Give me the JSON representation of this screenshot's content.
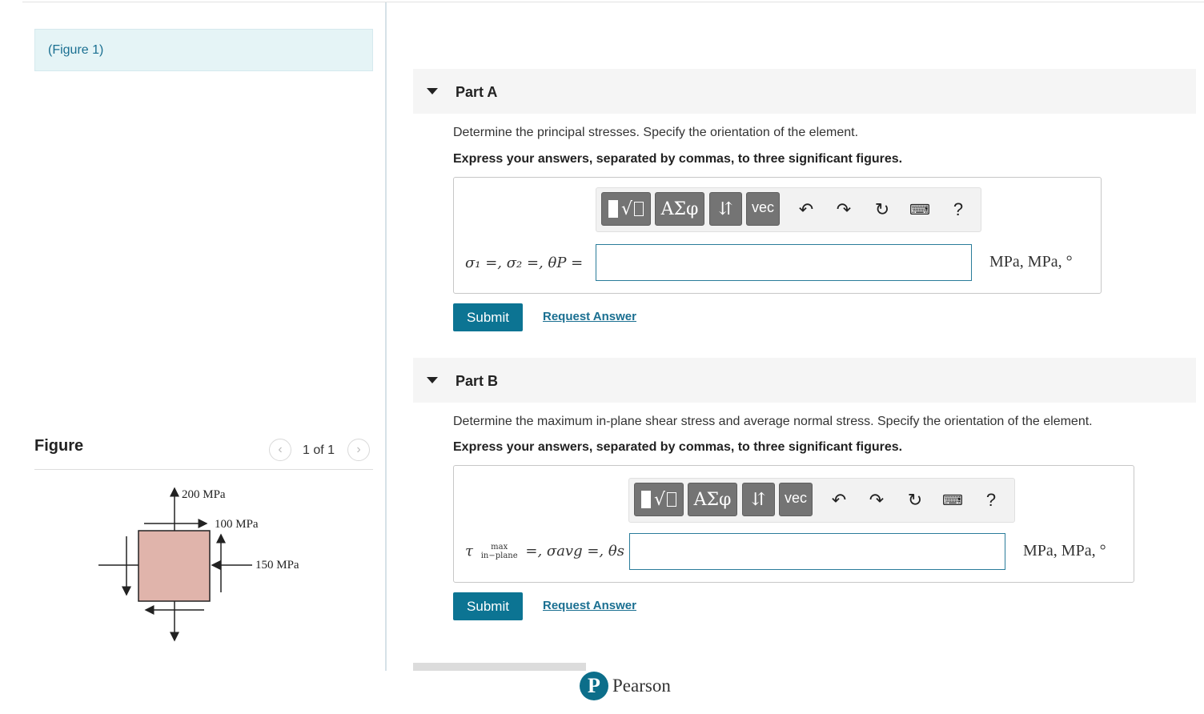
{
  "figure_panel": {
    "link_text": "(Figure 1)",
    "title": "Figure",
    "pager": "1 of 1",
    "figure_labels": {
      "top": "200 MPa",
      "shear": "100 MPa",
      "side": "150 MPa"
    }
  },
  "part_a": {
    "title": "Part A",
    "prompt": "Determine the principal stresses. Specify the orientation of the element.",
    "instruction": "Express your answers, separated by commas, to three significant figures.",
    "formula": "σ₁ =, σ₂ =, θP =",
    "answer_value": "",
    "units": "MPa, MPa, °",
    "submit_label": "Submit",
    "request_label": "Request Answer"
  },
  "part_b": {
    "title": "Part B",
    "prompt": "Determine the maximum in-plane shear stress and average normal stress. Specify the orientation of the element.",
    "instruction": "Express your answers, separated by commas, to three significant figures.",
    "formula_tau": "τ",
    "formula_sub_top": "max",
    "formula_sub_bottom": "in−plane",
    "formula_rest": "=, σavg =, θs =",
    "answer_value": "",
    "units": "MPa, MPa, °",
    "submit_label": "Submit",
    "request_label": "Request Answer"
  },
  "toolbar": {
    "templates": "√",
    "greek": "ΑΣφ",
    "arrows": "⇵",
    "vec": "vec",
    "help": "?"
  },
  "footer": {
    "logo_letter": "P",
    "brand": "Pearson"
  },
  "colors": {
    "accent": "#0c7493",
    "link": "#1a6f91",
    "figure_fill": "#e0b4ab"
  }
}
